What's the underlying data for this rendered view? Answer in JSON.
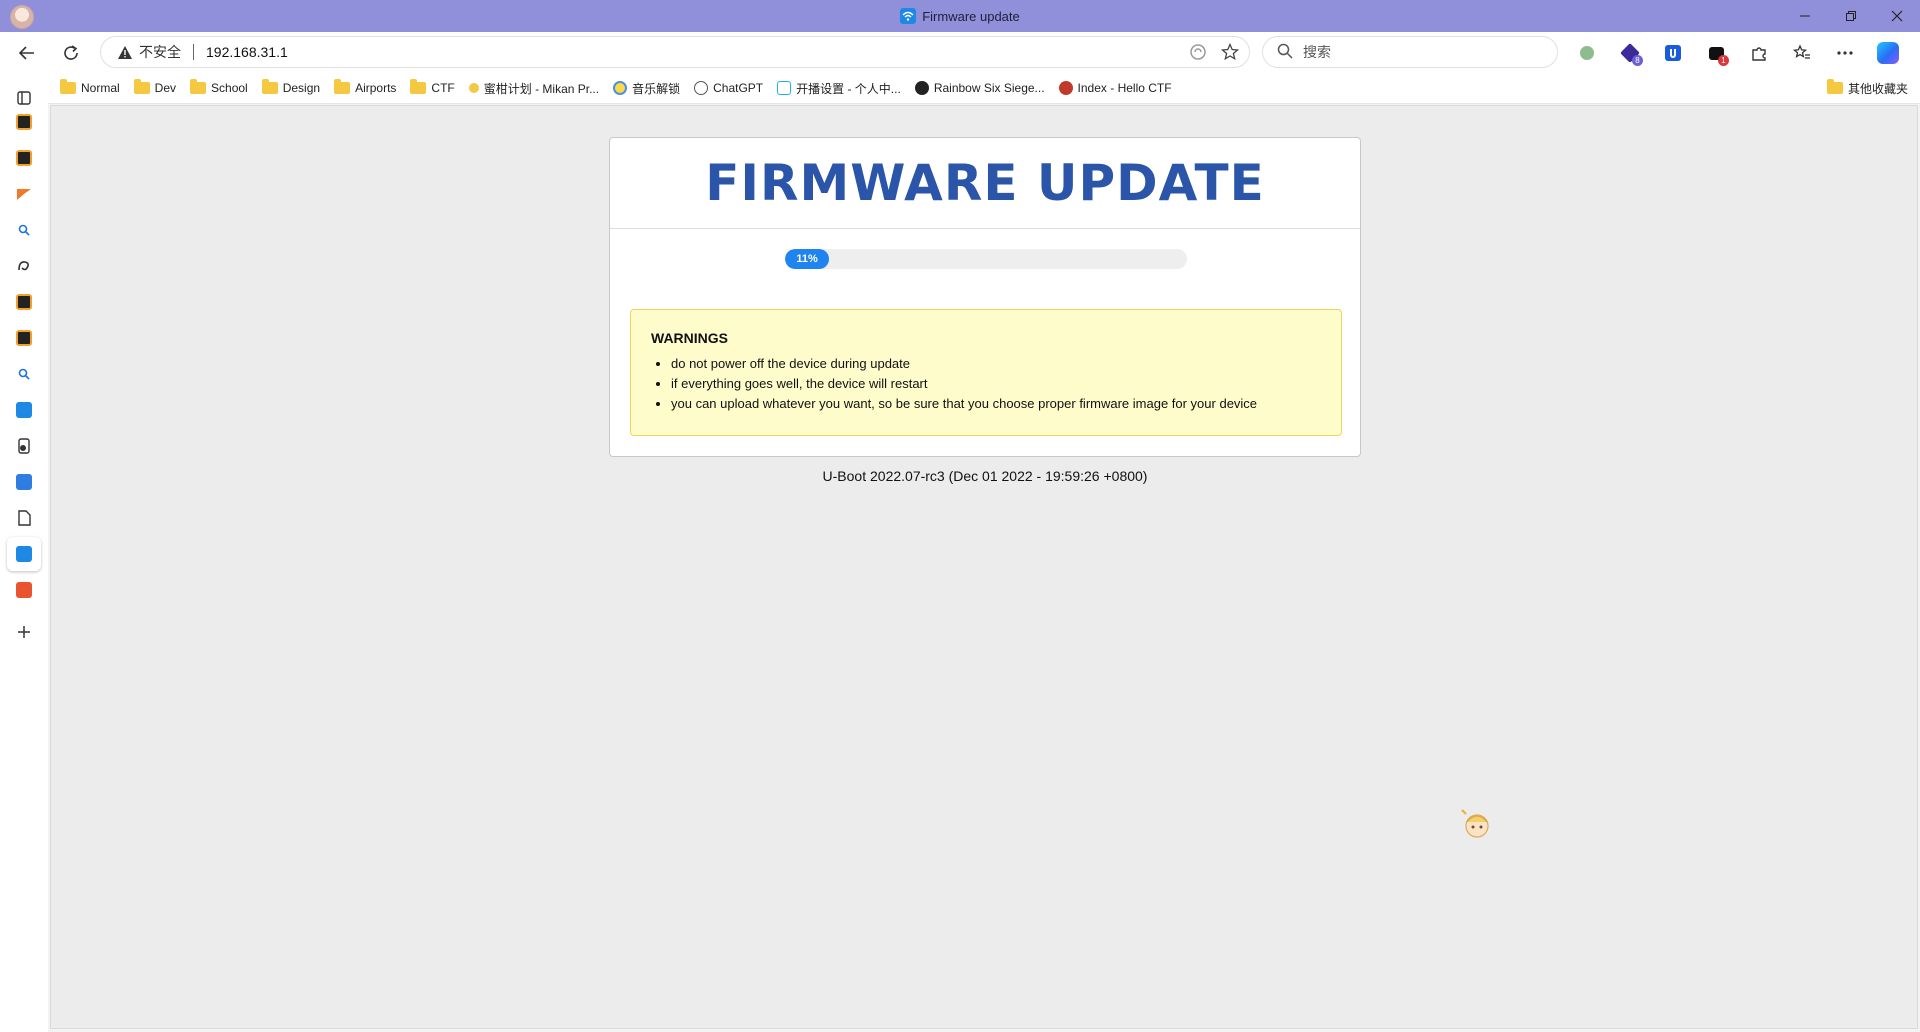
{
  "browser": {
    "tab_title": "Firmware update",
    "address": {
      "security_label": "不安全",
      "url": "192.168.31.1"
    },
    "search": {
      "placeholder": "搜索"
    },
    "extensions": [
      {
        "icon": "green-circle-icon"
      },
      {
        "icon": "purple-hex-icon",
        "badge": "8"
      },
      {
        "icon": "bitwarden-icon"
      },
      {
        "icon": "dark-square-icon",
        "badge": "1"
      },
      {
        "icon": "puzzle-icon"
      },
      {
        "icon": "favorites-icon"
      },
      {
        "icon": "more-icon"
      },
      {
        "icon": "copilot-icon"
      }
    ],
    "bookmarks": [
      {
        "label": "Normal",
        "type": "folder"
      },
      {
        "label": "Dev",
        "type": "folder"
      },
      {
        "label": "School",
        "type": "folder"
      },
      {
        "label": "Design",
        "type": "folder"
      },
      {
        "label": "Airports",
        "type": "folder"
      },
      {
        "label": "CTF",
        "type": "folder"
      },
      {
        "label": "蜜柑计划 - Mikan Pr...",
        "type": "link",
        "color": "#f5c842"
      },
      {
        "label": "音乐解锁",
        "type": "link",
        "color": "#4a90e2"
      },
      {
        "label": "ChatGPT",
        "type": "link",
        "color": "#555555"
      },
      {
        "label": "开播设置 - 个人中...",
        "type": "link",
        "color": "#23aee5"
      },
      {
        "label": "Rainbow Six Siege...",
        "type": "link",
        "color": "#222222"
      },
      {
        "label": "Index - Hello CTF",
        "type": "link",
        "color": "#c0392b"
      }
    ],
    "other_bookmarks": "其他收藏夹"
  },
  "sidebar_icons": [
    "app-icon-orange-1",
    "app-icon-orange-2",
    "app-icon-orange-flag",
    "search-icon-1",
    "app-icon-swirl",
    "app-icon-orange-3",
    "app-icon-orange-4",
    "search-icon-2",
    "wifi-app-icon",
    "document-app-icon",
    "docs-app-icon",
    "file-icon",
    "wifi-app-icon-active",
    "c-app-icon",
    "add-icon"
  ],
  "page": {
    "title": "FIRMWARE UPDATE",
    "progress": {
      "percent": 11,
      "label": "11%"
    },
    "warnings": {
      "title": "WARNINGS",
      "items": [
        "do not power off the device during update",
        "if everything goes well, the device will restart",
        "you can upload whatever you want, so be sure that you choose proper firmware image for your device"
      ]
    },
    "footer": "U-Boot 2022.07-rc3 (Dec 01 2022 - 19:59:26 +0800)"
  },
  "colors": {
    "titlebar": "#8f8fda",
    "title_text": "#2a55a8",
    "progress": "#1f83f0",
    "warning_bg": "#fffccc",
    "warning_border": "#f2d25a"
  }
}
